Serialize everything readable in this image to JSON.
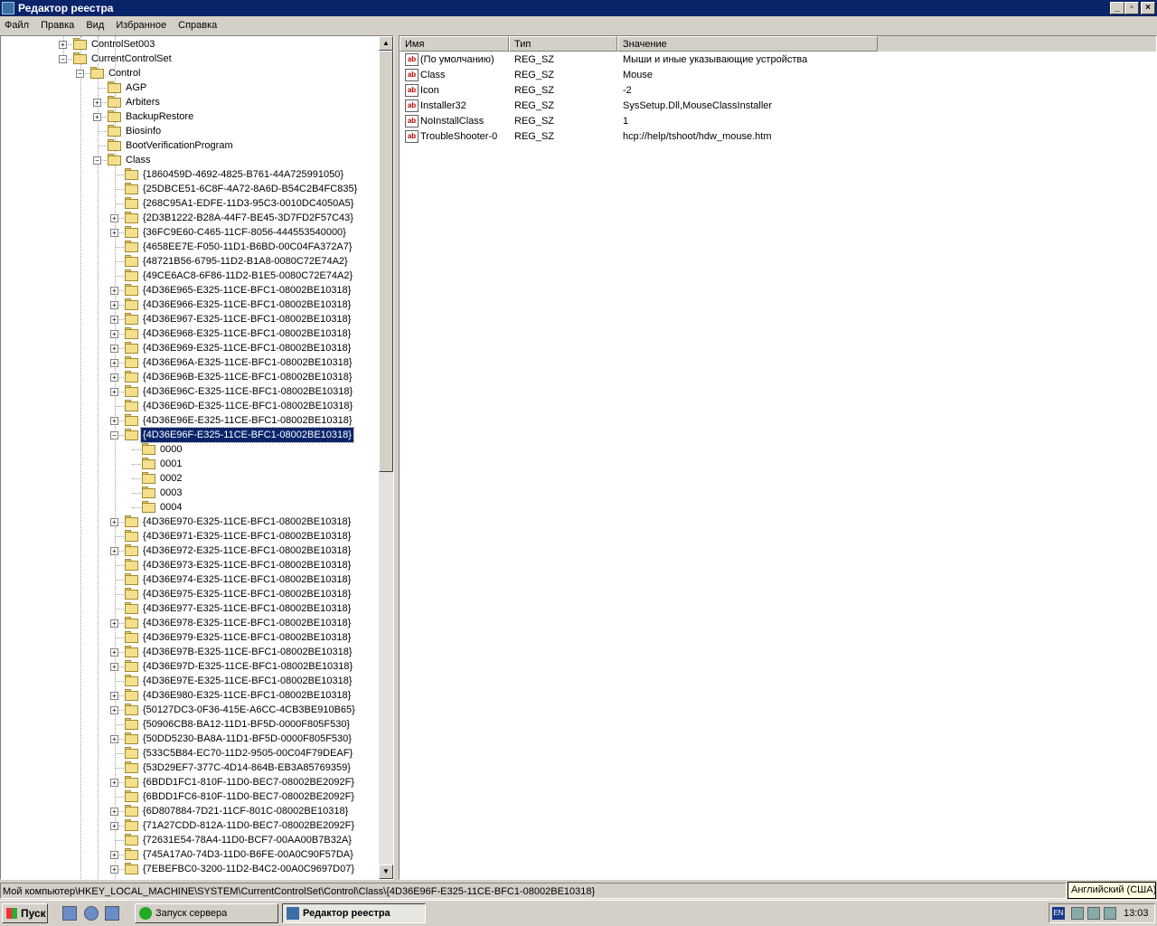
{
  "window": {
    "title": "Редактор реестра"
  },
  "menu": [
    {
      "label": "Файл"
    },
    {
      "label": "Правка"
    },
    {
      "label": "Вид"
    },
    {
      "label": "Избранное"
    },
    {
      "label": "Справка"
    }
  ],
  "tree": {
    "nodes": [
      {
        "label": "ControlSet003",
        "level": 0,
        "expander": "+"
      },
      {
        "label": "CurrentControlSet",
        "level": 0,
        "expander": "-"
      },
      {
        "label": "Control",
        "level": 1,
        "expander": "-"
      },
      {
        "label": "AGP",
        "level": 2,
        "expander": ""
      },
      {
        "label": "Arbiters",
        "level": 2,
        "expander": "+"
      },
      {
        "label": "BackupRestore",
        "level": 2,
        "expander": "+"
      },
      {
        "label": "Biosinfo",
        "level": 2,
        "expander": ""
      },
      {
        "label": "BootVerificationProgram",
        "level": 2,
        "expander": ""
      },
      {
        "label": "Class",
        "level": 2,
        "expander": "-"
      },
      {
        "label": "{1860459D-4692-4825-B761-44A725991050}",
        "level": 3,
        "expander": ""
      },
      {
        "label": "{25DBCE51-6C8F-4A72-8A6D-B54C2B4FC835}",
        "level": 3,
        "expander": ""
      },
      {
        "label": "{268C95A1-EDFE-11D3-95C3-0010DC4050A5}",
        "level": 3,
        "expander": ""
      },
      {
        "label": "{2D3B1222-B28A-44F7-BE45-3D7FD2F57C43}",
        "level": 3,
        "expander": "+"
      },
      {
        "label": "{36FC9E60-C465-11CF-8056-444553540000}",
        "level": 3,
        "expander": "+"
      },
      {
        "label": "{4658EE7E-F050-11D1-B6BD-00C04FA372A7}",
        "level": 3,
        "expander": ""
      },
      {
        "label": "{48721B56-6795-11D2-B1A8-0080C72E74A2}",
        "level": 3,
        "expander": ""
      },
      {
        "label": "{49CE6AC8-6F86-11D2-B1E5-0080C72E74A2}",
        "level": 3,
        "expander": ""
      },
      {
        "label": "{4D36E965-E325-11CE-BFC1-08002BE10318}",
        "level": 3,
        "expander": "+"
      },
      {
        "label": "{4D36E966-E325-11CE-BFC1-08002BE10318}",
        "level": 3,
        "expander": "+"
      },
      {
        "label": "{4D36E967-E325-11CE-BFC1-08002BE10318}",
        "level": 3,
        "expander": "+"
      },
      {
        "label": "{4D36E968-E325-11CE-BFC1-08002BE10318}",
        "level": 3,
        "expander": "+"
      },
      {
        "label": "{4D36E969-E325-11CE-BFC1-08002BE10318}",
        "level": 3,
        "expander": "+"
      },
      {
        "label": "{4D36E96A-E325-11CE-BFC1-08002BE10318}",
        "level": 3,
        "expander": "+"
      },
      {
        "label": "{4D36E96B-E325-11CE-BFC1-08002BE10318}",
        "level": 3,
        "expander": "+"
      },
      {
        "label": "{4D36E96C-E325-11CE-BFC1-08002BE10318}",
        "level": 3,
        "expander": "+"
      },
      {
        "label": "{4D36E96D-E325-11CE-BFC1-08002BE10318}",
        "level": 3,
        "expander": ""
      },
      {
        "label": "{4D36E96E-E325-11CE-BFC1-08002BE10318}",
        "level": 3,
        "expander": "+"
      },
      {
        "label": "{4D36E96F-E325-11CE-BFC1-08002BE10318}",
        "level": 3,
        "expander": "-",
        "selected": true
      },
      {
        "label": "0000",
        "level": 4,
        "expander": ""
      },
      {
        "label": "0001",
        "level": 4,
        "expander": ""
      },
      {
        "label": "0002",
        "level": 4,
        "expander": ""
      },
      {
        "label": "0003",
        "level": 4,
        "expander": ""
      },
      {
        "label": "0004",
        "level": 4,
        "expander": ""
      },
      {
        "label": "{4D36E970-E325-11CE-BFC1-08002BE10318}",
        "level": 3,
        "expander": "+"
      },
      {
        "label": "{4D36E971-E325-11CE-BFC1-08002BE10318}",
        "level": 3,
        "expander": ""
      },
      {
        "label": "{4D36E972-E325-11CE-BFC1-08002BE10318}",
        "level": 3,
        "expander": "+"
      },
      {
        "label": "{4D36E973-E325-11CE-BFC1-08002BE10318}",
        "level": 3,
        "expander": ""
      },
      {
        "label": "{4D36E974-E325-11CE-BFC1-08002BE10318}",
        "level": 3,
        "expander": ""
      },
      {
        "label": "{4D36E975-E325-11CE-BFC1-08002BE10318}",
        "level": 3,
        "expander": ""
      },
      {
        "label": "{4D36E977-E325-11CE-BFC1-08002BE10318}",
        "level": 3,
        "expander": ""
      },
      {
        "label": "{4D36E978-E325-11CE-BFC1-08002BE10318}",
        "level": 3,
        "expander": "+"
      },
      {
        "label": "{4D36E979-E325-11CE-BFC1-08002BE10318}",
        "level": 3,
        "expander": ""
      },
      {
        "label": "{4D36E97B-E325-11CE-BFC1-08002BE10318}",
        "level": 3,
        "expander": "+"
      },
      {
        "label": "{4D36E97D-E325-11CE-BFC1-08002BE10318}",
        "level": 3,
        "expander": "+"
      },
      {
        "label": "{4D36E97E-E325-11CE-BFC1-08002BE10318}",
        "level": 3,
        "expander": ""
      },
      {
        "label": "{4D36E980-E325-11CE-BFC1-08002BE10318}",
        "level": 3,
        "expander": "+"
      },
      {
        "label": "{50127DC3-0F36-415E-A6CC-4CB3BE910B65}",
        "level": 3,
        "expander": "+"
      },
      {
        "label": "{50906CB8-BA12-11D1-BF5D-0000F805F530}",
        "level": 3,
        "expander": ""
      },
      {
        "label": "{50DD5230-BA8A-11D1-BF5D-0000F805F530}",
        "level": 3,
        "expander": "+"
      },
      {
        "label": "{533C5B84-EC70-11D2-9505-00C04F79DEAF}",
        "level": 3,
        "expander": ""
      },
      {
        "label": "{53D29EF7-377C-4D14-864B-EB3A85769359}",
        "level": 3,
        "expander": ""
      },
      {
        "label": "{6BDD1FC1-810F-11D0-BEC7-08002BE2092F}",
        "level": 3,
        "expander": "+"
      },
      {
        "label": "{6BDD1FC6-810F-11D0-BEC7-08002BE2092F}",
        "level": 3,
        "expander": ""
      },
      {
        "label": "{6D807884-7D21-11CF-801C-08002BE10318}",
        "level": 3,
        "expander": "+"
      },
      {
        "label": "{71A27CDD-812A-11D0-BEC7-08002BE2092F}",
        "level": 3,
        "expander": "+"
      },
      {
        "label": "{72631E54-78A4-11D0-BCF7-00AA00B7B32A}",
        "level": 3,
        "expander": ""
      },
      {
        "label": "{745A17A0-74D3-11D0-B6FE-00A0C90F57DA}",
        "level": 3,
        "expander": "+"
      },
      {
        "label": "{7EBEFBC0-3200-11D2-B4C2-00A0C9697D07}",
        "level": 3,
        "expander": "+"
      }
    ]
  },
  "list": {
    "columns": [
      "Имя",
      "Тип",
      "Значение"
    ],
    "rows": [
      {
        "name": "(По умолчанию)",
        "type": "REG_SZ",
        "value": "Мыши и иные указывающие устройства"
      },
      {
        "name": "Class",
        "type": "REG_SZ",
        "value": "Mouse"
      },
      {
        "name": "Icon",
        "type": "REG_SZ",
        "value": "-2"
      },
      {
        "name": "Installer32",
        "type": "REG_SZ",
        "value": "SysSetup.Dll,MouseClassInstaller"
      },
      {
        "name": "NoInstallClass",
        "type": "REG_SZ",
        "value": "1"
      },
      {
        "name": "TroubleShooter-0",
        "type": "REG_SZ",
        "value": "hcp://help/tshoot/hdw_mouse.htm"
      }
    ]
  },
  "statusbar": {
    "path": "Мой компьютер\\HKEY_LOCAL_MACHINE\\SYSTEM\\CurrentControlSet\\Control\\Class\\{4D36E96F-E325-11CE-BFC1-08002BE10318}"
  },
  "tooltip": {
    "text": "Английский (США)"
  },
  "taskbar": {
    "start_label": "Пуск",
    "tasks": [
      {
        "label": "Запуск сервера",
        "active": false
      },
      {
        "label": "Редактор реестра",
        "active": true
      }
    ],
    "lang": "EN",
    "clock": "13:03"
  },
  "icons": {
    "value_icon": "string-value-icon",
    "folder": "folder-icon",
    "colors": {
      "titlebar": "#0a246a",
      "selection": "#0a246a",
      "folder": "#f4e08c"
    }
  }
}
